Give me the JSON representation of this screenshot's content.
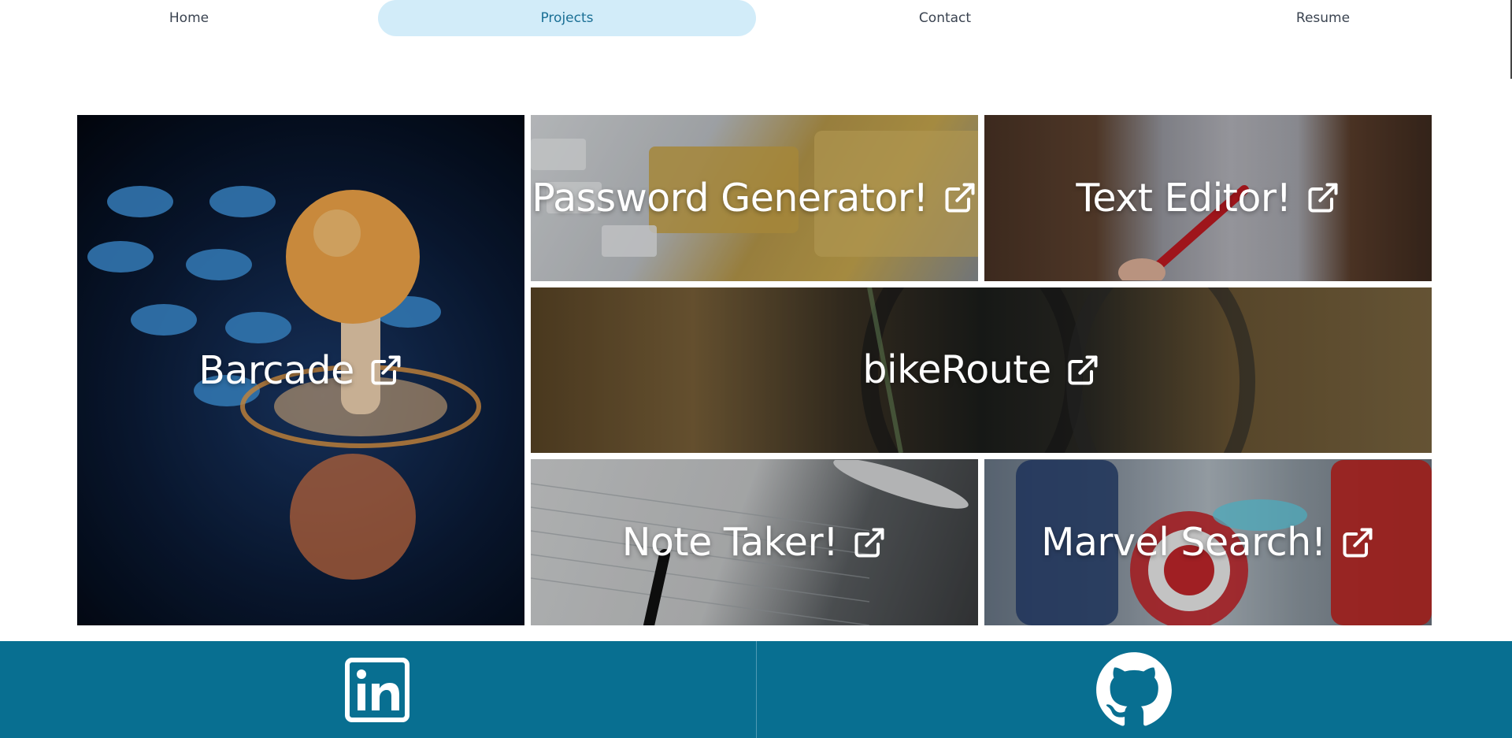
{
  "nav": {
    "items": [
      {
        "label": "Home",
        "active": false
      },
      {
        "label": "Projects",
        "active": true
      },
      {
        "label": "Contact",
        "active": false
      },
      {
        "label": "Resume",
        "active": false
      }
    ]
  },
  "projects": [
    {
      "key": "barcade",
      "title": "Barcade",
      "icon": "external-link-icon"
    },
    {
      "key": "password",
      "title": "Password Generator!",
      "icon": "external-link-icon"
    },
    {
      "key": "text",
      "title": "Text Editor!",
      "icon": "external-link-icon"
    },
    {
      "key": "bike",
      "title": "bikeRoute",
      "icon": "external-link-icon"
    },
    {
      "key": "note",
      "title": "Note Taker!",
      "icon": "external-link-icon"
    },
    {
      "key": "marvel",
      "title": "Marvel Search!",
      "icon": "external-link-icon"
    }
  ],
  "footer": {
    "links": [
      {
        "icon": "linkedin-icon"
      },
      {
        "icon": "github-icon"
      }
    ]
  },
  "colors": {
    "nav_active_bg": "#d2ecf9",
    "nav_active_text": "#1a6f95",
    "nav_text": "#3a4350",
    "footer_bg": "#086f91"
  }
}
